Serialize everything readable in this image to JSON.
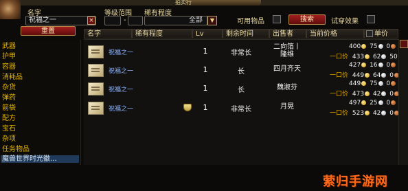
{
  "window": {
    "title_tab": "拍卖行"
  },
  "search": {
    "name_label": "名字",
    "name_value": "祝福之一",
    "level_label": "等级范围",
    "level_min": "",
    "level_sep": "-",
    "level_max": "",
    "rarity_label": "稀有程度",
    "rarity_value": "全部",
    "usable_label": "可用物品",
    "search_button": "搜索",
    "preview_label": "试穿效果",
    "reset_button": "重置"
  },
  "categories": [
    {
      "label": "武器"
    },
    {
      "label": "护甲"
    },
    {
      "label": "容器"
    },
    {
      "label": "消耗品"
    },
    {
      "label": "杂货"
    },
    {
      "label": "弹药"
    },
    {
      "label": "箭袋"
    },
    {
      "label": "配方"
    },
    {
      "label": "宝石"
    },
    {
      "label": "杂项"
    },
    {
      "label": "任务物品"
    },
    {
      "label": "魔兽世界时光徽..."
    }
  ],
  "columns": {
    "name": "名字",
    "rarity": "稀有程度",
    "level": "Lv",
    "time_left": "剩余时间",
    "seller": "出售者",
    "price": "当前价格",
    "unit_price": "单价"
  },
  "buyout_label": "一口价",
  "rows": [
    {
      "name": "祝福之一",
      "qty": "1",
      "time": "非常长",
      "seller": "二向箔丨隆维",
      "bid": {
        "g": "400",
        "s": "75",
        "c": "0"
      },
      "buy": {
        "g": "433",
        "s": "62",
        "c": "50"
      },
      "quest": false
    },
    {
      "name": "祝福之一",
      "qty": "1",
      "time": "长",
      "seller": "四月齐天",
      "bid": {
        "g": "427",
        "s": "16",
        "c": "0"
      },
      "buy": {
        "g": "449",
        "s": "64",
        "c": "0"
      },
      "quest": false
    },
    {
      "name": "祝福之一",
      "qty": "1",
      "time": "长",
      "seller": "魏淑芬",
      "bid": {
        "g": "449",
        "s": "75",
        "c": "0"
      },
      "buy": {
        "g": "473",
        "s": "42",
        "c": "0"
      },
      "quest": false
    },
    {
      "name": "祝福之一",
      "qty": "1",
      "time": "非常长",
      "seller": "月晃",
      "bid": {
        "g": "497",
        "s": "25",
        "c": "0"
      },
      "buy": {
        "g": "523",
        "s": "42",
        "c": "0"
      },
      "quest": true
    }
  ],
  "watermark": "萦归手游网",
  "colors": {
    "accent_red": "#a41e1e",
    "selected": "#1f3a5a",
    "item_name": "#8fb6ff",
    "category": "#e0b000"
  },
  "icons": {
    "item": "scroll-icon",
    "quest": "shield-icon"
  }
}
